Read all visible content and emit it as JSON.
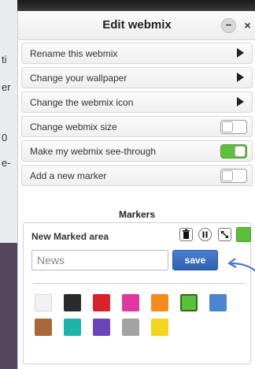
{
  "background_fragments": [
    "ti",
    "er",
    "0",
    "e-"
  ],
  "dialog": {
    "title": "Edit webmix",
    "minimize_symbol": "−",
    "close_symbol": "×"
  },
  "menu": {
    "rename": "Rename this webmix",
    "wallpaper": "Change your wallpaper",
    "icon": "Change the webmix icon",
    "size": "Change webmix size",
    "see_through": "Make my webmix see-through",
    "add_marker": "Add a new marker"
  },
  "toggles": {
    "size": false,
    "see_through": true,
    "add_marker": false
  },
  "markers": {
    "title": "Markers",
    "area_title": "New Marked area",
    "name_placeholder": "News",
    "save_label": "save",
    "current_color": "#5cbf3b",
    "tool_icons": [
      "trash-icon",
      "pause-icon",
      "resize-icon"
    ],
    "colors": [
      "#f2f2f2",
      "#2a2a2a",
      "#d8232a",
      "#e0389f",
      "#f58a1f",
      "#5cbf3b",
      "#4a86d0",
      "#a8693a",
      "#1fb3aa",
      "#6b45b8",
      "#a3a3a3",
      "#f2d51c"
    ],
    "selected_color_index": 5
  }
}
